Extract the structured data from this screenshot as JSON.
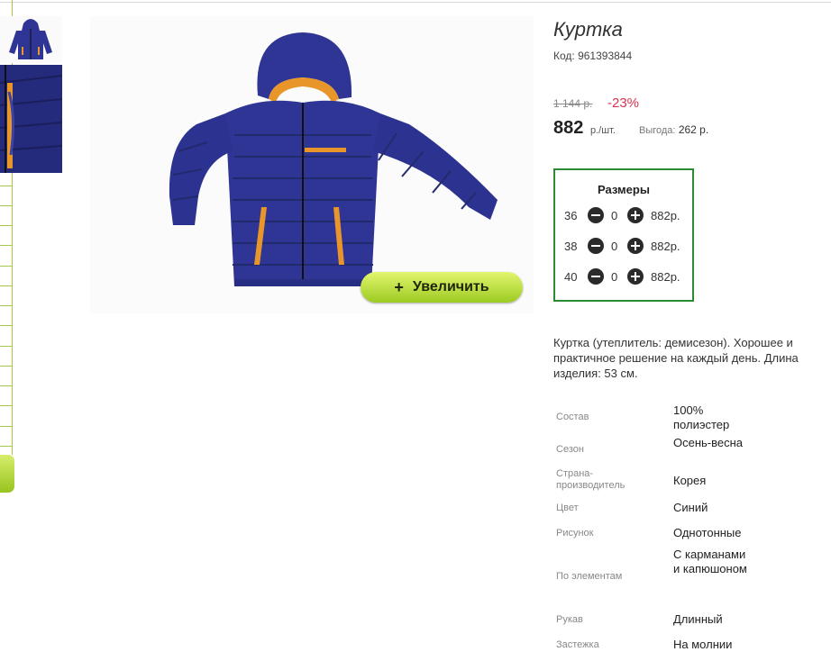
{
  "product": {
    "title": "Куртка",
    "code": "Код: 961393844"
  },
  "pricing": {
    "old_price": "1 144 р.",
    "discount": "-23%",
    "price": "882",
    "price_unit": "р./шт.",
    "benefit_label": "Выгода:",
    "benefit_value": "262 р."
  },
  "gallery": {
    "zoom_label": "Увеличить",
    "zoom_icon": "plus-icon"
  },
  "sizes": {
    "title": "Размеры",
    "rows": [
      {
        "size": "36",
        "qty": "0",
        "price": "882р."
      },
      {
        "size": "38",
        "qty": "0",
        "price": "882р."
      },
      {
        "size": "40",
        "qty": "0",
        "price": "882р."
      }
    ]
  },
  "description": "Куртка (утеплитель: демисезон). Хорошее и практичное решение на каждый день. Длина изделия: 53 см.",
  "attributes": [
    {
      "key": "Состав",
      "value": "100% полиэстер"
    },
    {
      "key": "Сезон",
      "value": "Осень-весна"
    },
    {
      "key": "Страна-производитель",
      "value": "Корея"
    },
    {
      "key": "Цвет",
      "value": "Синий"
    },
    {
      "key": "Рисунок",
      "value": "Однотонные"
    },
    {
      "key": "По элементам",
      "value": "С карманами и капюшоном"
    },
    {
      "key": "Рукав",
      "value": "Длинный"
    },
    {
      "key": "Застежка",
      "value": "На молнии"
    }
  ],
  "colors": {
    "accent_green": "#2e8a32",
    "discount_red": "#d9334f",
    "button_green": "#9ccb22",
    "jacket_blue": "#2f3594",
    "jacket_trim": "#e8962a"
  }
}
